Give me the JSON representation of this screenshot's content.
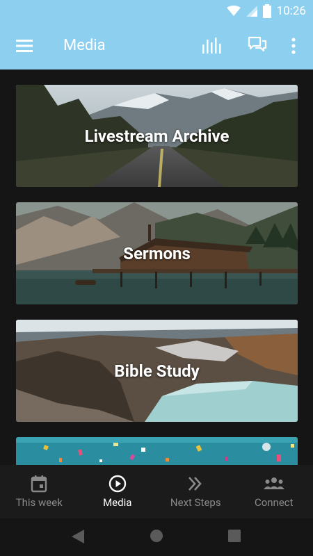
{
  "status_bar": {
    "time": "10:26"
  },
  "app_bar": {
    "title": "Media"
  },
  "cards": [
    {
      "label": "Livestream Archive"
    },
    {
      "label": "Sermons"
    },
    {
      "label": "Bible Study"
    },
    {
      "label": ""
    }
  ],
  "bottom_nav": {
    "items": [
      {
        "label": "This week",
        "icon": "calendar-icon",
        "active": false
      },
      {
        "label": "Media",
        "icon": "play-circle-icon",
        "active": true
      },
      {
        "label": "Next Steps",
        "icon": "double-chevron-right-icon",
        "active": false
      },
      {
        "label": "Connect",
        "icon": "group-icon",
        "active": false
      }
    ]
  },
  "colors": {
    "app_bar": "#8ccfee",
    "background": "#151515",
    "nav_inactive": "#8a8a8a",
    "nav_active": "#ffffff"
  }
}
